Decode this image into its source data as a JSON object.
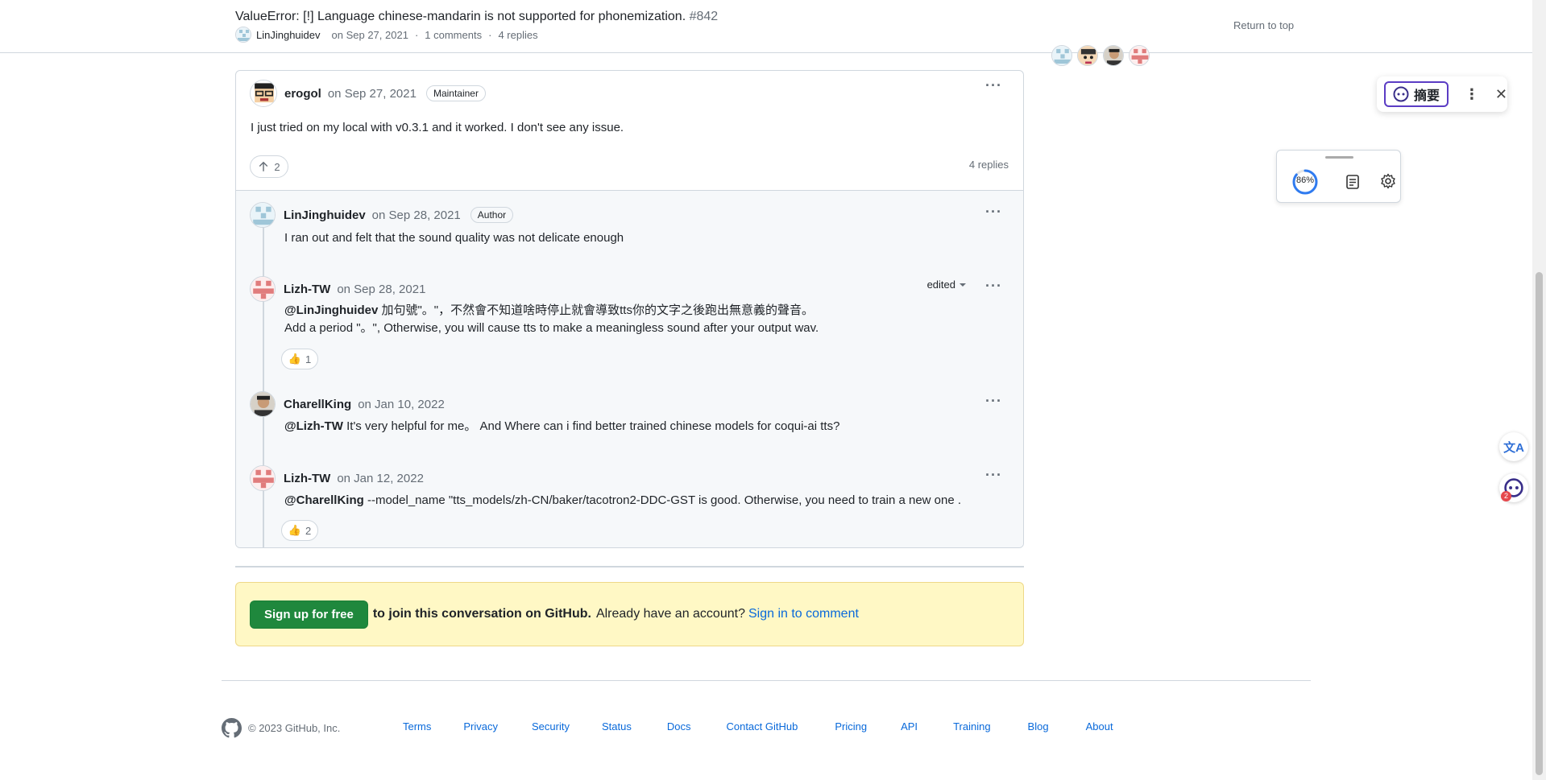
{
  "header": {
    "title": "ValueError: [!] Language chinese-mandarin is not supported for phonemization.",
    "issue_number": "#842",
    "author": "LinJinghuidev",
    "date": "on Sep 27, 2021",
    "comments": "1 comments",
    "replies": "4 replies",
    "return_top": "Return to top"
  },
  "main_comment": {
    "user": "erogol",
    "date": "on Sep 27, 2021",
    "badge": "Maintainer",
    "body": "I just tried on my local with v0.3.1 and it worked. I don't see any issue.",
    "upvotes": "2",
    "replies_label": "4 replies"
  },
  "replies": [
    {
      "user": "LinJinghuidev",
      "date": "on Sep 28, 2021",
      "badge": "Author",
      "body": "I ran out and felt that the sound quality was not delicate enough"
    },
    {
      "user": "Lizh-TW",
      "date": "on Sep 28, 2021",
      "edited": "edited",
      "mention": "@LinJinghuidev",
      "body_line1": " 加句號\"。\"，不然會不知道啥時停止就會導致tts你的文字之後跑出無意義的聲音。",
      "body_line2": "Add a period \"。\", Otherwise, you will cause tts to make a meaningless sound after your output wav.",
      "reaction": "1"
    },
    {
      "user": "CharellKing",
      "date": "on Jan 10, 2022",
      "mention": "@Lizh-TW",
      "body": " It's very helpful for me。 And Where can i find better trained chinese models for coqui-ai tts?"
    },
    {
      "user": "Lizh-TW",
      "date": "on Jan 12, 2022",
      "mention": "@CharellKing",
      "body": " --model_name \"tts_models/zh-CN/baker/tacotron2-DDC-GST is good. Otherwise, you need to train a new one .",
      "reaction": "2"
    }
  ],
  "signup": {
    "button": "Sign up for free",
    "text": "to join this conversation on GitHub.",
    "text2": "Already have an account?",
    "link": "Sign in to comment"
  },
  "footer": {
    "copyright": "© 2023 GitHub, Inc.",
    "links": [
      "Terms",
      "Privacy",
      "Security",
      "Status",
      "Docs",
      "Contact GitHub",
      "Pricing",
      "API",
      "Training",
      "Blog",
      "About"
    ]
  },
  "extension": {
    "summary_label": "摘要",
    "progress_label": "86%",
    "progress": 0.86
  },
  "colors": {
    "link": "#0969da",
    "signup_green": "#1f883d",
    "signup_bg": "#fff8c5",
    "accent_purple": "#5b3cc4"
  },
  "icons": [
    "github-logo-icon",
    "arrow-up-icon",
    "thumbs-up-icon",
    "kebab-menu-icon",
    "caret-down-icon",
    "close-icon",
    "translate-icon",
    "notes-icon",
    "gear-icon",
    "robot-icon"
  ]
}
